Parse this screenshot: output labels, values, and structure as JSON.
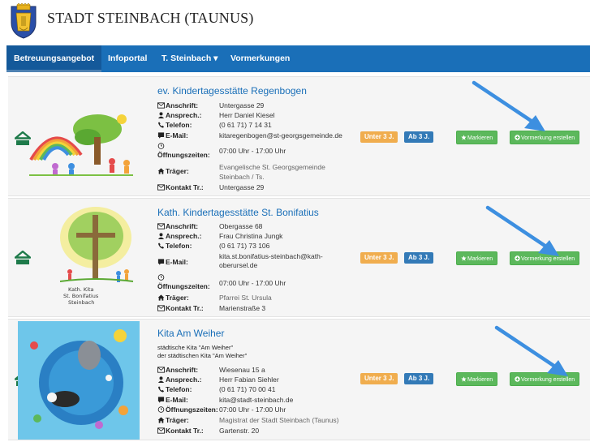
{
  "header": {
    "site_title": "STADT STEINBACH (TAUNUS)"
  },
  "nav": {
    "items": [
      {
        "label": "Betreuungsangebot"
      },
      {
        "label": "Infoportal"
      },
      {
        "label": "T. Steinbach ▾"
      },
      {
        "label": "Vormerkungen"
      }
    ]
  },
  "labels": {
    "anschrift": "Anschrift:",
    "ansprech": "Ansprech.:",
    "telefon": "Telefon:",
    "email": "E-Mail:",
    "oeffnung": "Öffnungszeiten:",
    "traeger": "Träger:",
    "kontakt": "Kontakt Tr.:"
  },
  "badges": {
    "under3": "Unter 3 J.",
    "over3": "Ab 3 J."
  },
  "buttons": {
    "markieren": "Markieren",
    "vormerkung": "Vormerkung erstellen"
  },
  "kitas": [
    {
      "title": "ev. Kindertagesstätte Regenbogen",
      "anschrift": "Untergasse 29",
      "ansprech": "Herr Daniel Kiesel",
      "telefon": "(0 61 71) 7 14 31",
      "email": "kitaregenbogen@st-georgsgemeinde.de",
      "oeffnung": "07:00 Uhr - 17:00 Uhr",
      "traeger_1": "Evangelische St. Georgsgemeinde",
      "traeger_2": "Steinbach / Ts.",
      "kontakt": "Untergasse 29"
    },
    {
      "title": "Kath. Kindertagesstätte St. Bonifatius",
      "anschrift": "Obergasse 68",
      "ansprech": "Frau Christina Jungk",
      "telefon": "(0 61 71) 73 106",
      "email_1": "kita.st.bonifatius-steinbach@kath-",
      "email_2": "oberursel.de",
      "oeffnung": "07:00 Uhr - 17:00 Uhr",
      "traeger": "Pfarrei St. Ursula",
      "kontakt": "Marienstraße 3",
      "logo_text": [
        "Kath. Kita",
        "St. Bonifatius",
        "Steinbach"
      ]
    },
    {
      "title": "Kita Am Weiher",
      "desc_1": "städtische Kita \"Am Weiher\"",
      "desc_2": "der städtischen Kita \"Am Weiher\"",
      "anschrift": "Wiesenau 15 a",
      "ansprech": "Herr Fabian Siehler",
      "telefon": "(0 61 71) 70 00 41",
      "email": "kita@stadt-steinbach.de",
      "oeffnung": "07:00 Uhr - 17:00 Uhr",
      "traeger": "Magistrat der Stadt Steinbach (Taunus)",
      "kontakt": "Gartenstr. 20"
    }
  ],
  "colors": {
    "nav_blue": "#1a6fb8",
    "link_blue": "#1a6fb8",
    "green": "#5cb85c",
    "orange": "#f0ad4e",
    "badge_blue": "#337ab7",
    "arrow_blue": "#3d8fe0",
    "home_green": "#1e7a4a"
  }
}
